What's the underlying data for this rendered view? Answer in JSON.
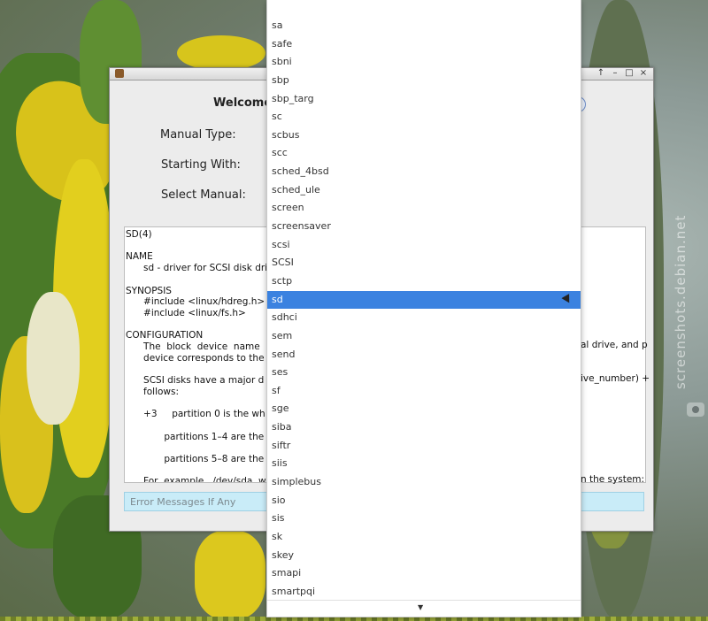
{
  "window": {
    "welcome_text": "Welcome",
    "labels": {
      "manual_type": "Manual Type:",
      "starting_with": "Starting With:",
      "select_manual": "Select Manual:"
    },
    "controls": [
      "↑",
      "–",
      "□",
      "×"
    ],
    "manual_text": "SD(4)\n\nNAME\n      sd - driver for SCSI disk dri\n\nSYNOPSIS\n      #include <linux/hdreg.h>\n      #include <linux/fs.h>\n\nCONFIGURATION\n      The  block  device  name\n      device corresponds to the\n\n      SCSI disks have a major d\n      follows:\n\n      +3     partition 0 is the wh\n\n             partitions 1–4 are the\n\n             partitions 5–8 are the\n\n      For  example,  /dev/sda  w",
    "right_fragments": [
      "al drive, and p",
      "ive_number) +",
      "n the system:"
    ],
    "error_placeholder": "Error Messages If Any"
  },
  "dropdown": {
    "items": [
      "sa",
      "safe",
      "sbni",
      "sbp",
      "sbp_targ",
      "sc",
      "scbus",
      "scc",
      "sched_4bsd",
      "sched_ule",
      "screen",
      "screensaver",
      "scsi",
      "SCSI",
      "sctp",
      "sd",
      "sdhci",
      "sem",
      "send",
      "ses",
      "sf",
      "sge",
      "siba",
      "siftr",
      "siis",
      "simplebus",
      "sio",
      "sis",
      "sk",
      "skey",
      "smapi",
      "smartpqi"
    ],
    "selected": "sd",
    "scroll_arrow": "▼"
  },
  "watermark": "screenshots.debian.net",
  "colors": {
    "selection": "#3b82e0",
    "error_bg": "#c9ecf8"
  }
}
